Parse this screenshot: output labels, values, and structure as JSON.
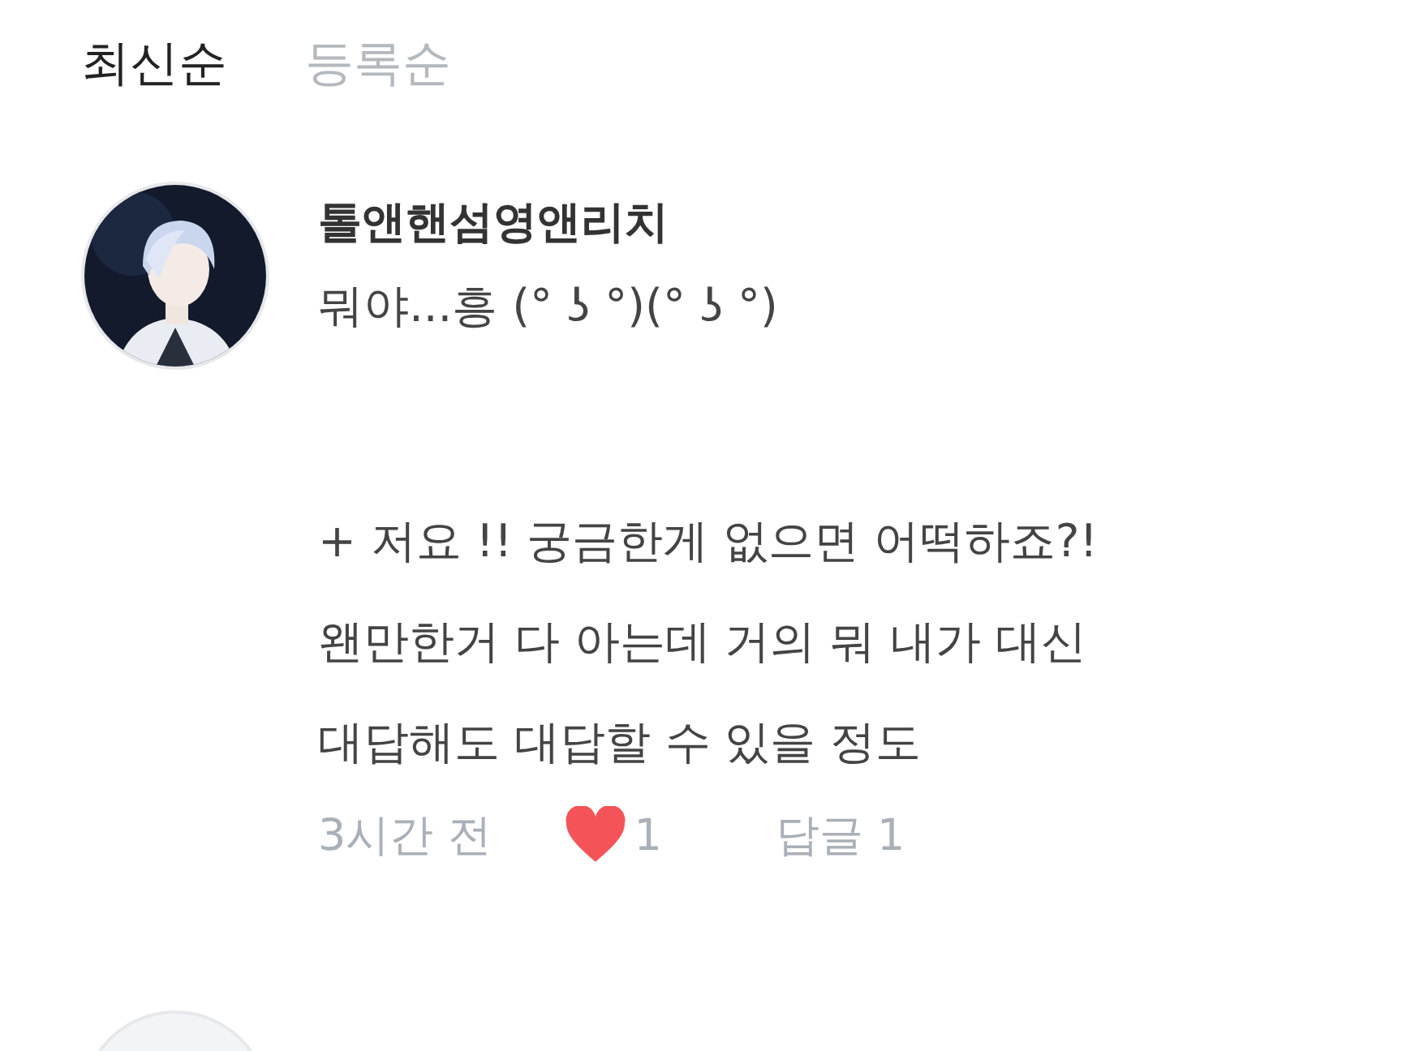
{
  "sort_tabs": [
    {
      "label": "최신순",
      "selected": true
    },
    {
      "label": "등록순",
      "selected": false
    }
  ],
  "comments": [
    {
      "kind": "full",
      "author": "톨앤핸섬영앤리치",
      "avatar": {
        "kind": "picture"
      },
      "body": [
        [
          "뭐야...흥 (° ʖ °)(° ʖ °)"
        ],
        [
          "+ 저요 !! 궁금한게 없으면 어떡하죠?!",
          "왠만한거 다 아는데 거의 뭐 내가 대신",
          "대답해도 대답할 수 있을 정도"
        ]
      ],
      "time": "3시간 전",
      "likes": "1",
      "liked": true,
      "reply_label": "답글",
      "reply_count": "1"
    },
    {
      "kind": "cut"
    }
  ]
}
